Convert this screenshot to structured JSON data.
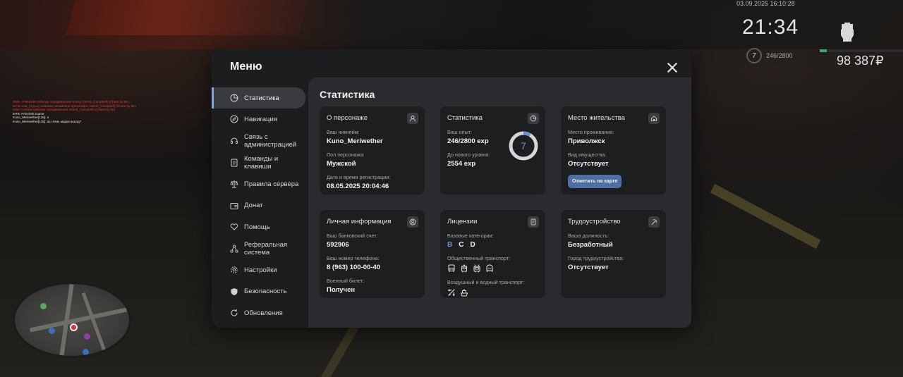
{
  "hud": {
    "datetime": "03.09.2025 16:10:28",
    "time": "21:34",
    "level": "7",
    "exp": "246/2800",
    "exp_fraction": 0.0879,
    "money": "98 387₽"
  },
  "chat": [
    {
      "text": "SMS: 37960298 кабинки передвижения поезд Gelent_Campbell) (Cheat by 5K)",
      "color": "red"
    },
    {
      "text": "Вечеслав_(отдых) кабинки неизменно прочитайте Gelent_Campbell) (Cheat by 5K)",
      "color": "red"
    },
    {
      "text": "Gilari Centrail кабинки передвижения Grand_Campbell) (Cheat by 5K)",
      "color": "red"
    },
    {
      "text": "MTB: Privolzsk Game",
      "color": "white"
    },
    {
      "text": "Kuno_Meriwether[135]: а",
      "color": "white"
    },
    {
      "text": "Kuno_Meriwether[135]: ах глянь марки ахалд?",
      "color": "white"
    }
  ],
  "menu": {
    "title": "Меню",
    "sidebar": [
      {
        "label": "Статистика",
        "icon": "pie-chart-icon",
        "active": true
      },
      {
        "label": "Навигация",
        "icon": "compass-icon"
      },
      {
        "label": "Связь с\nадминистрацией",
        "icon": "headset-icon"
      },
      {
        "label": "Команды и\nклавиши",
        "icon": "document-icon"
      },
      {
        "label": "Правила сервера",
        "icon": "scales-icon"
      },
      {
        "label": "Донат",
        "icon": "wallet-icon"
      },
      {
        "label": "Помощь",
        "icon": "heart-hand-icon"
      },
      {
        "label": "Реферальная\nсистема",
        "icon": "network-icon"
      },
      {
        "label": "Настройки",
        "icon": "gear-icon"
      },
      {
        "label": "Безопасность",
        "icon": "shield-icon"
      },
      {
        "label": "Обновления",
        "icon": "refresh-icon"
      }
    ],
    "section_title": "Статистика",
    "cards": {
      "person": {
        "title": "О персонаже",
        "nickname_label": "Ваш никнейм:",
        "nickname": "Kuno_Meriwether",
        "gender_label": "Пол персонажа:",
        "gender": "Мужской",
        "reg_label": "Дата и время регистрации:",
        "reg": "08.05.2025 20:04:46"
      },
      "stats": {
        "title": "Статистика",
        "exp_label": "Ваш опыт:",
        "exp": "246/2800 exp",
        "next_label": "До нового уровня:",
        "next": "2554 exp",
        "level": "7",
        "progress": 0.0879
      },
      "residence": {
        "title": "Место жительства",
        "place_label": "Место проживания:",
        "place": "Приволжск",
        "property_label": "Вид имущества:",
        "property": "Отсутствует",
        "map_button": "Отметить на карте"
      },
      "personal": {
        "title": "Личная информация",
        "bank_label": "Ваш банковский счет:",
        "bank": "592906",
        "phone_label": "Ваш номер телефона:",
        "phone": "8 (963) 100-00-40",
        "military_label": "Военный билет:",
        "military": "Получен"
      },
      "licenses": {
        "title": "Лицензии",
        "base_label": "Базовые категории:",
        "categories": [
          {
            "letter": "B",
            "owned": true
          },
          {
            "letter": "C",
            "owned": false
          },
          {
            "letter": "D",
            "owned": false
          }
        ],
        "public_label": "Общественный транспорт:",
        "public_icons": [
          "bus-icon",
          "tram-icon",
          "trolleybus-icon",
          "metro-icon"
        ],
        "air_label": "Воздушный и водный транспорт:",
        "air_icons": [
          "plane-icon",
          "boat-icon"
        ]
      },
      "work": {
        "title": "Трудоустройство",
        "position_label": "Ваша должность:",
        "position": "Безработный",
        "city_label": "Город трудоустройства:",
        "city": "Отсутствует"
      }
    }
  },
  "colors": {
    "accent": "#6d93cf",
    "button": "#4f6ea3",
    "modal_bg": "#1c1d1f",
    "content_bg": "#2a2b2e",
    "card_bg": "#1d1e20",
    "exp_bar": "#3fa870"
  }
}
